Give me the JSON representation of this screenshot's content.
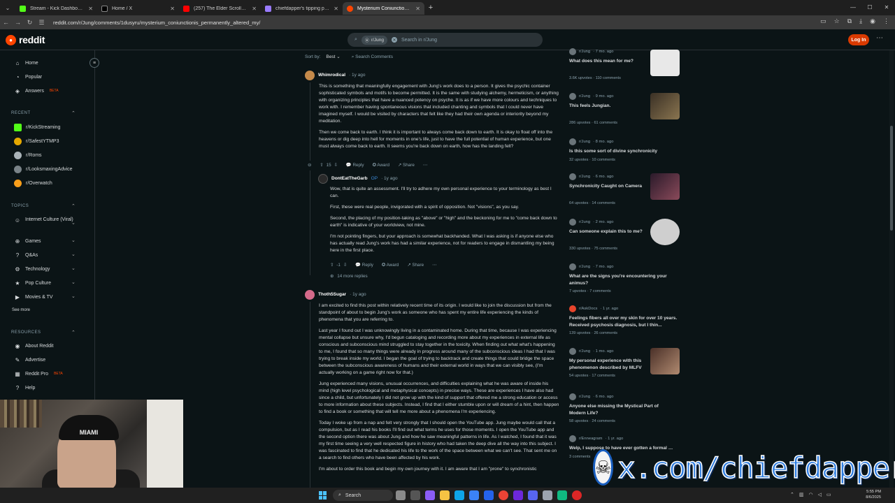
{
  "browser": {
    "tabs": [
      {
        "title": "Stream - Kick Dashboard",
        "color": "#53fc18"
      },
      {
        "title": "Home / X",
        "color": "#ffffff"
      },
      {
        "title": "(257) The Elder Scrolls VI: Sk...",
        "color": "#ff0000"
      },
      {
        "title": "chiefdapper's tipping page",
        "color": "#9a7bff"
      },
      {
        "title": "Mysterium Coniunctionis perma...",
        "color": "#ff4500"
      }
    ],
    "url": "reddit.com/r/Jung/comments/1dusyru/mysterium_coniunctionis_permanently_altered_my/"
  },
  "header": {
    "logo": "reddit",
    "search_chip": "r/Jung",
    "search_placeholder": "Search in r/Jung",
    "login": "Log In"
  },
  "sidebar": {
    "home": "Home",
    "popular": "Popular",
    "answers": "Answers",
    "beta": "BETA",
    "recent_head": "RECENT",
    "recent": [
      "r/KickStreaming",
      "r/SafestYTMP3",
      "r/Roms",
      "r/LooksmaxingAdvice",
      "r/Overwatch"
    ],
    "topics_head": "TOPICS",
    "topics": [
      "Internet Culture (Viral)",
      "Games",
      "Q&As",
      "Technology",
      "Pop Culture",
      "Movies & TV"
    ],
    "see_more": "See more",
    "resources_head": "RESOURCES",
    "resources": [
      "About Reddit",
      "Advertise",
      "Reddit Pro",
      "Help"
    ]
  },
  "comments": {
    "sort_label": "Sort by:",
    "sort_value": "Best",
    "search_comments": "Search Comments",
    "c1": {
      "author": "Whimrodical",
      "time": "1y ago",
      "p1": "This is something that meaningfully engagement with Jung's work does to a person. It gives the psychic container sophisticated symbols and motifs to become permitted. It is the same with studying alchemy, hermeticism, or anything with organizing principles that have a nuanced potency on psyche. It is as if we have more colours and techniques to work with. I remember having spontaneous visions that included chanting and symbols that I could never have imagined myself. I would be visited by characters that felt like they had their own agenda or interiority beyond my meditation.",
      "p2": "Then we come back to earth. I think it is important to always come back down to earth. It is okay to float off into the heavens or dig deep into hell for moments in one's life, just to have the full potential of human experience, but one must always come back to earth. It seems you're back down on earth, how has the landing felt?",
      "votes": "15",
      "reply": "Reply",
      "award": "Award",
      "share": "Share"
    },
    "c2": {
      "author": "DontEatTheGarb",
      "op": "OP",
      "time": "1y ago",
      "p1": "Wow, that is quite an assessment. I'll try to adhere my own personal experience to your terminology as best I can.",
      "p2": "First, these were real people, invigorated with a spirit of opposition. Not \"visions\", as you say.",
      "p3": "Second, the placing of my position-taking as \"above\" or \"high\" and the beckoning for me to \"come back down to earth\" is indicative of your worldview, not mine.",
      "p4": "I'm not pointing fingers, but your approach is somewhat backhanded. What I was asking is if anyone else who has actually read Jung's work has had a similar experience, not for readers to engage in dismantling my being here in the first place.",
      "votes": "-1",
      "reply": "Reply",
      "award": "Award",
      "share": "Share",
      "more_replies": "14 more replies"
    },
    "c3": {
      "author": "Thoth5Sugar",
      "time": "1y ago",
      "p1": "I am excited to find this post within relatively recent time of its origin. I would like to join the discussion but from the standpoint of about to begin Jung's work as someone who has spent my entire life experiencing the kinds of phenomena that you are referring to.",
      "p2": "Last year I found out I was unknowingly living in a contaminated home. During that time, because I was experiencing mental collapse but unsure why, I'd begun cataloging and recording more about my experiences in external life as conscious and subconscious mind struggled to stay together in the toxicity. When finding out what what's happening to me, I found that so many things were already in progress around many of the subconscious ideas I had that I was trying to break inside my world. I began the goal of trying to backtrack and create things that could bridge the space between the subconscious awareness of humans and their external world in ways that we can visibly see, (I'm actually working on a game right now for that.)",
      "p3": "Jung experienced many visions, unusual occurrences, and difficulties explaining what he was aware of inside his mind (high level psychological and metaphysical concepts) in precise ways. These are experiences I have also had since a child, but unfortunately I did not grow up with the kind of support that offered me a strong education or access to more information about these subjects. Instead, I find that I either stumble upon or will dream of a hint, then happen to find a book or something that will tell me more about a phenomena I'm experiencing.",
      "p4": "Today I woke up from a nap and felt very strongly that I should open the YouTube app. Jung maybe would call that a compulsion, but as I read his books I'll find out what terms he uses for those moments. I open the YouTube app and the second option there was about Jung and how he saw meaningful patterns in life. As I watched, I found that it was my first time seeing a very well respected figure in history who had taken the deep dive all the way into this subject. I was fascinated to find that he dedicated his life to the work of the space between what we can't see. That sent me on a search to find others who have been affected by his work.",
      "p5": "I'm about to order this book and begin my own journey with it. I am aware that I am \"prone\" to synchronistic"
    }
  },
  "related": [
    {
      "sub": "r/Jung",
      "time": "7 mo. ago",
      "title": "What does this mean for me?",
      "stats": "3.6K upvotes · 110 comments",
      "thumb": "#e8e8e8"
    },
    {
      "sub": "r/Jung",
      "time": "9 mo. ago",
      "title": "This feels Jungian.",
      "stats": "286 upvotes · 61 comments",
      "thumb": "#6b5a3e"
    },
    {
      "sub": "r/Jung",
      "time": "8 mo. ago",
      "title": "Is this some sort of divine synchronicity",
      "stats": "32 upvotes · 10 comments",
      "thumb": ""
    },
    {
      "sub": "r/Jung",
      "time": "6 mo. ago",
      "title": "Synchronicity Caught on Camera",
      "stats": "64 upvotes · 14 comments",
      "thumb": "#4a2a3a"
    },
    {
      "sub": "r/Jung",
      "time": "2 mo. ago",
      "title": "Can someone explain this to me?",
      "stats": "330 upvotes · 75 comments",
      "thumb": "#cfcfcf"
    },
    {
      "sub": "r/Jung",
      "time": "7 mo. ago",
      "title": "What are the signs you're encountering your animus?",
      "stats": "7 upvotes · 7 comments",
      "thumb": ""
    },
    {
      "sub": "r/AskDocs",
      "time": "1 yr. ago",
      "title": "Feelings fibers all over my skin for over 10 years. Received psychosis diagnosis, but I thin...",
      "stats": "139 upvotes · 26 comments",
      "thumb": ""
    },
    {
      "sub": "r/Jung",
      "time": "1 mo. ago",
      "title": "My personal experience with this phenomenon described by MLFV",
      "stats": "54 upvotes · 17 comments",
      "thumb": "#8a6a5a"
    },
    {
      "sub": "r/Jung",
      "time": "6 mo. ago",
      "title": "Anyone else missing the Mystical Part of Modern Life?",
      "stats": "58 upvotes · 24 comments",
      "thumb": ""
    },
    {
      "sub": "r/Enneagram",
      "time": "1 yr. ago",
      "title": "Welp, I suppose to have ever gotten a formal assessment ... gram community ...",
      "stats": "3 comments",
      "thumb": ""
    }
  ],
  "overlay": {
    "cap_text": "MIAMI",
    "watermark": "x.com/chiefdapper"
  },
  "taskbar": {
    "search": "Search",
    "time": "5:55 PM",
    "date": "8/6/2025"
  }
}
